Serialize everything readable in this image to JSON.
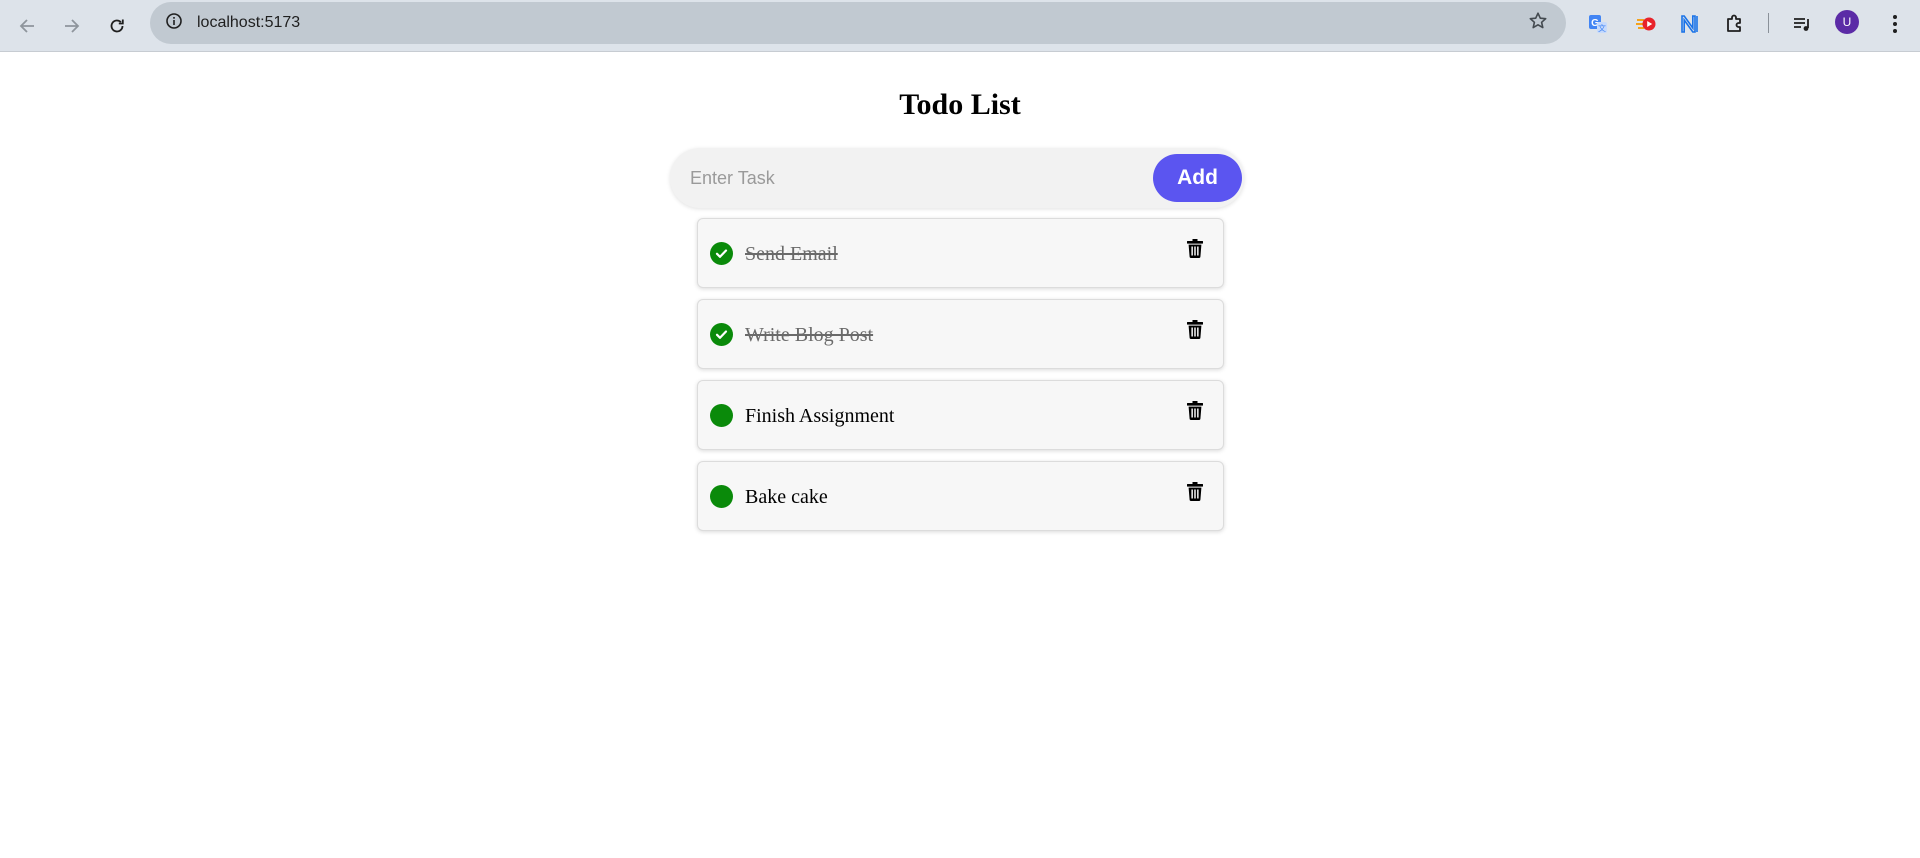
{
  "browser": {
    "url": "localhost:5173",
    "profile_initial": "U"
  },
  "app": {
    "title": "Todo List",
    "input": {
      "placeholder": "Enter Task",
      "value": ""
    },
    "add_label": "Add",
    "accent_color": "#5b55f0",
    "check_color": "#0a8a0a"
  },
  "todos": [
    {
      "text": "Send Email",
      "completed": true
    },
    {
      "text": "Write Blog Post",
      "completed": true
    },
    {
      "text": "Finish Assignment",
      "completed": false
    },
    {
      "text": "Bake cake",
      "completed": false
    }
  ]
}
